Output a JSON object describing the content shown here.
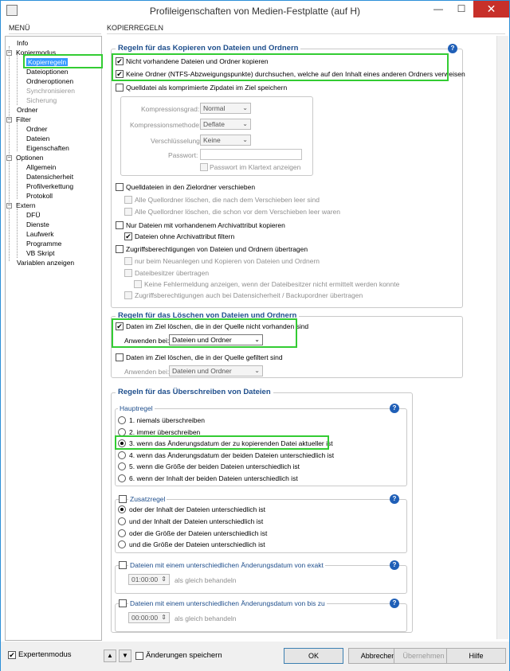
{
  "window": {
    "title": "Profileigenschaften von Medien-Festplatte (auf H)",
    "min": "—",
    "max": "☐",
    "close": "✕"
  },
  "headers": {
    "menu": "MENÜ",
    "section": "KOPIERREGELN"
  },
  "tree": [
    "Info",
    "Kopiermodus",
    "Kopierregeln",
    "Dateioptionen",
    "Ordneroptionen",
    "Synchronisieren",
    "Sicherung",
    "Ordner",
    "Filter",
    "Ordner",
    "Dateien",
    "Eigenschaften",
    "Optionen",
    "Allgemein",
    "Datensicherheit",
    "Profilverkettung",
    "Protokoll",
    "Extern",
    "DFÜ",
    "Dienste",
    "Laufwerk",
    "Programme",
    "VB Skript",
    "Variablen anzeigen"
  ],
  "copy": {
    "title": "Regeln für das Kopieren von Dateien und Ordnern",
    "opt1": "Nicht vorhandene Dateien und Ordner kopieren",
    "opt2": "Keine Ordner (NTFS-Abzweigungspunkte) durchsuchen, welche auf den Inhalt eines anderen Ordners verweisen",
    "zip": "Quelldatei als komprimierte Zipdatei im Ziel speichern",
    "comp_lbl": "Kompressionsgrad:",
    "comp_val": "Normal",
    "meth_lbl": "Kompressionsmethode:",
    "meth_val": "Deflate",
    "enc_lbl": "Verschlüsselung:",
    "enc_val": "Keine",
    "pw_lbl": "Passwort:",
    "pw_plain": "Passwort im Klartext anzeigen",
    "move": "Quelldateien in den Zielordner verschieben",
    "move_a": "Alle Quellordner löschen, die nach dem Verschieben leer sind",
    "move_b": "Alle Quellordner löschen, die schon vor dem Verschieben leer waren",
    "arch": "Nur Dateien mit vorhandenem Archivattribut kopieren",
    "arch_f": "Dateien ohne Archivattribut filtern",
    "acl": "Zugriffsberechtigungen von Dateien und Ordnern übertragen",
    "acl_a": "nur beim Neuanlegen und Kopieren von Dateien und Ordnern",
    "acl_b": "Dateibesitzer übertragen",
    "acl_c": "Keine Fehlermeldung anzeigen, wenn der Dateibesitzer nicht ermittelt werden konnte",
    "acl_d": "Zugriffsberechtigungen auch bei Datensicherheit / Backupordner übertragen"
  },
  "del": {
    "title": "Regeln für das Löschen von Dateien und Ordnern",
    "opt1": "Daten im Ziel löschen, die in der Quelle nicht vorhanden sind",
    "apply_lbl": "Anwenden bei:",
    "apply_val": "Dateien und Ordner",
    "opt2": "Daten im Ziel löschen, die in der Quelle gefiltert sind",
    "apply2_lbl": "Anwenden bei:",
    "apply2_val": "Dateien und Ordner"
  },
  "over": {
    "title": "Regeln für das Überschreiben von Dateien",
    "main": "Hauptregel",
    "r1": "1. niemals überschreiben",
    "r2": "2. immer überschreiben",
    "r3": "3. wenn das Änderungsdatum der zu kopierenden Datei aktueller ist",
    "r4": "4. wenn das Änderungsdatum der beiden Dateien unterschiedlich ist",
    "r5": "5. wenn die Größe der beiden Dateien unterschiedlich ist",
    "r6": "6. wenn der Inhalt der beiden Dateien unterschiedlich ist",
    "extra": "Zusatzregel",
    "z1": "oder der Inhalt der Dateien unterschiedlich ist",
    "z2": "und der Inhalt der Dateien unterschiedlich ist",
    "z3": "oder die Größe der Dateien unterschiedlich ist",
    "z4": "und die Größe der Dateien unterschiedlich ist",
    "exact": "Dateien mit einem unterschiedlichen Änderungsdatum von exakt",
    "exact_val": "01:00:00",
    "same": "als gleich behandeln",
    "upto": "Dateien mit einem unterschiedlichen Änderungsdatum von bis zu",
    "upto_val": "00:00:00",
    "same2": "als gleich behandeln"
  },
  "footer": {
    "expert": "Expertenmodus",
    "save": "Änderungen speichern",
    "ok": "OK",
    "cancel": "Abbrechen",
    "apply": "Übernehmen",
    "help": "Hilfe"
  }
}
